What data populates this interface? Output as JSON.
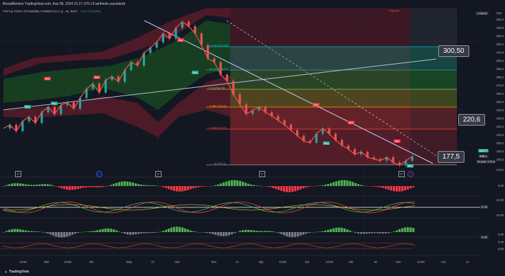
{
  "header": {
    "publisher_line": "BorsaMerkezi TradingView.com, Kas 09, 2024 21:17 UTC+3 tarihinde yayınlandı",
    "symbol_line": "TOFAŞ TÜRK OTOMOBİL FABRİKASI A.Ş., 4s, BIST",
    "change": "+0,2 (+0,10%)"
  },
  "currency": "TRY",
  "footer": {
    "brand": "TradingView"
  },
  "callouts": [
    "300,50",
    "220,6",
    "177,5"
  ],
  "price_tags": {
    "high_label": "Yüksek",
    "low_label": "Düşük",
    "low_value": "179,5",
    "last_green": "191,7",
    "last_grey": "186,1"
  },
  "y_axis": [
    "350,0",
    "340,0",
    "330,0",
    "320,0",
    "310,0",
    "300,0",
    "290,0",
    "280,0",
    "270,0",
    "260,0",
    "250,0",
    "240,0",
    "230,0",
    "220,0",
    "210,0",
    "200,0",
    "190,0",
    "180,0",
    "170,0"
  ],
  "x_axis": [
    "13:00",
    "Mar",
    "13:00",
    "Nis",
    "May",
    "17",
    "Haz",
    "Tem",
    "17",
    "Ağu",
    "13:00",
    "Eyl",
    "13:00",
    "Eki",
    "16",
    "Kas",
    "13:00",
    "Ara",
    "17"
  ],
  "fib_levels": [
    "0.786 (315,58)",
    "0.618 (286,20)",
    "0.5 (265,25)",
    "0.382 (244,6)",
    "0.236 (219,0)",
    "0 (177,1)"
  ],
  "fib_top_label": "Kapanış",
  "panels": {
    "p2_labels": [
      "0,00"
    ],
    "p3_labels": [
      "10,00",
      "0,00",
      "-10,00"
    ],
    "p4_labels": [
      "0,00",
      "0,00"
    ],
    "p5_labels": [
      "0,00",
      "0,00"
    ]
  },
  "events": [
    "E",
    "D",
    "E",
    "E",
    "E",
    "S"
  ],
  "signals": {
    "sell": "Sell",
    "buy": "Buy"
  },
  "chart_data": {
    "type": "line",
    "series": [
      {
        "values": [
          222,
          226,
          219,
          230,
          235,
          228,
          240,
          246,
          238,
          248,
          251,
          244,
          256,
          266,
          272,
          262,
          276,
          280,
          274,
          287,
          296,
          292,
          306,
          312,
          318,
          328,
          322,
          334,
          341,
          336,
          328,
          315,
          300,
          296,
          282,
          275,
          260,
          249,
          238,
          242,
          246,
          240,
          236,
          231,
          226,
          220,
          214,
          208,
          206,
          216,
          222,
          216,
          209,
          203,
          199,
          193,
          196,
          190,
          188,
          186,
          190,
          184,
          181,
          186,
          191
        ]
      }
    ],
    "ylim": [
      170,
      356
    ]
  }
}
